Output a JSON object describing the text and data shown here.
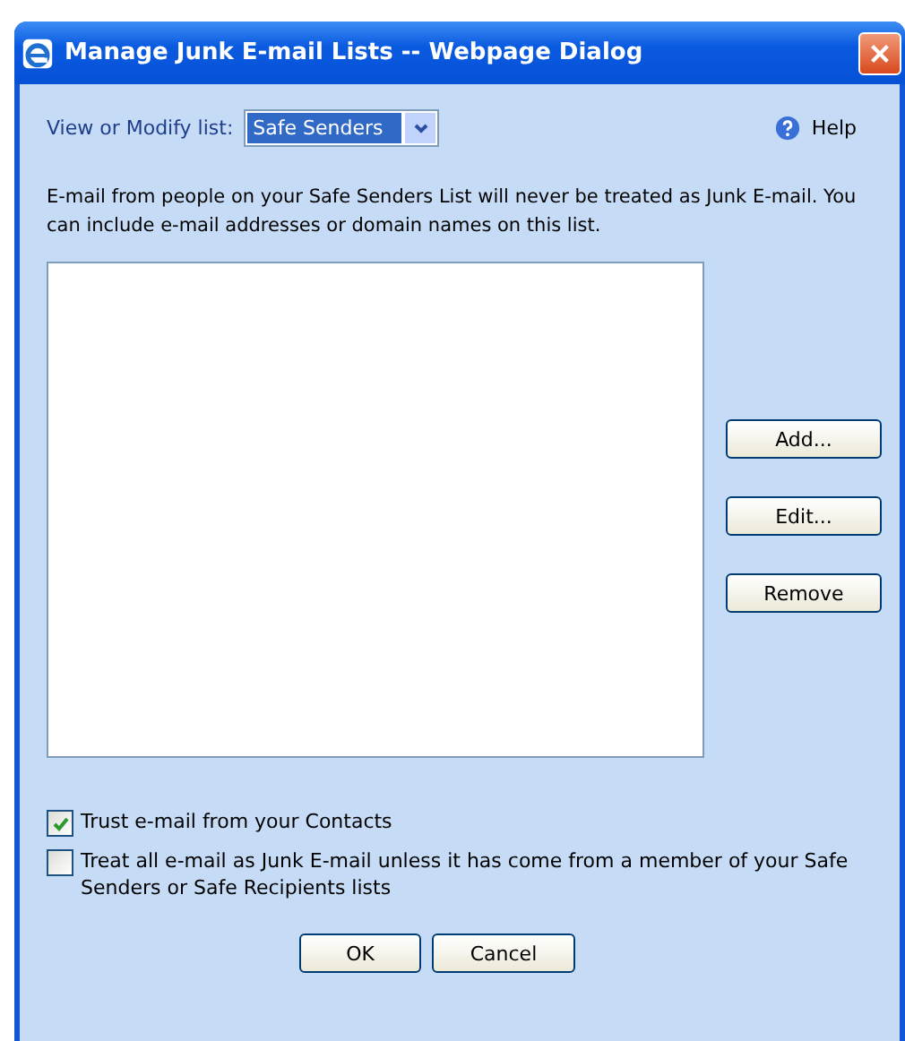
{
  "window": {
    "title": "Manage Junk E-mail Lists -- Webpage Dialog"
  },
  "list_selector": {
    "label": "View or Modify list:",
    "value": "Safe Senders"
  },
  "help": {
    "label": "Help"
  },
  "description": "E-mail from people on your Safe Senders List will never be treated as Junk E-mail. You can include e-mail addresses or domain names on this list.",
  "side_buttons": [
    "Add...",
    "Edit...",
    "Remove"
  ],
  "options": [
    {
      "label": "Trust e-mail from your Contacts",
      "checked": true
    },
    {
      "label": "Treat all e-mail as Junk E-mail unless it has come from a member of your Safe Senders or Safe Recipients lists",
      "checked": false
    }
  ],
  "buttons": [
    "OK",
    "Cancel"
  ]
}
